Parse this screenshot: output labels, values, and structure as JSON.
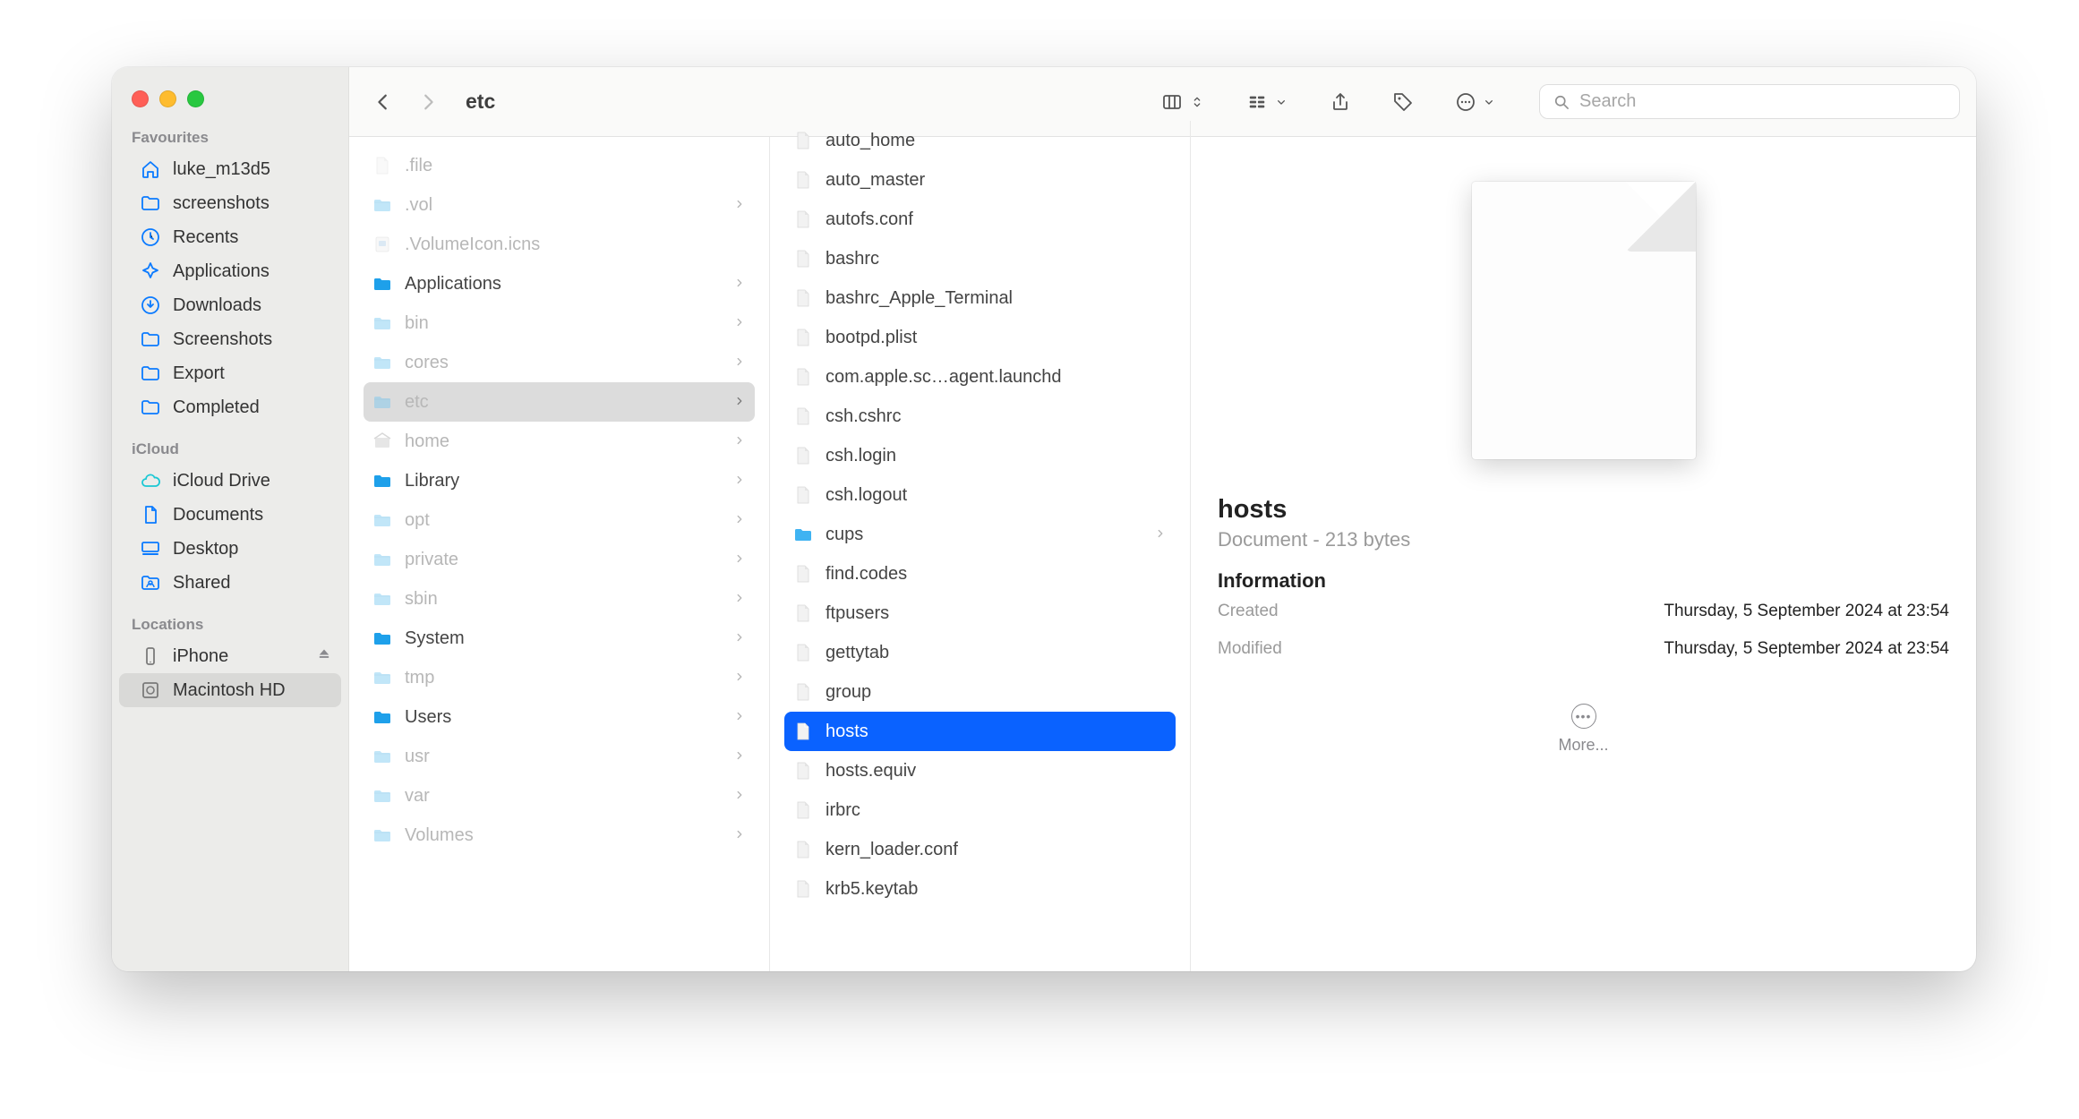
{
  "window": {
    "title": "etc"
  },
  "search": {
    "placeholder": "Search"
  },
  "sidebar": {
    "sections": [
      {
        "label": "Favourites",
        "items": [
          {
            "icon": "house",
            "label": "luke_m13d5"
          },
          {
            "icon": "folder",
            "label": "screenshots"
          },
          {
            "icon": "clock",
            "label": "Recents"
          },
          {
            "icon": "apps",
            "label": "Applications"
          },
          {
            "icon": "download",
            "label": "Downloads"
          },
          {
            "icon": "folder",
            "label": "Screenshots"
          },
          {
            "icon": "folder",
            "label": "Export"
          },
          {
            "icon": "folder",
            "label": "Completed"
          }
        ]
      },
      {
        "label": "iCloud",
        "items": [
          {
            "icon": "cloud",
            "label": "iCloud Drive"
          },
          {
            "icon": "doc",
            "label": "Documents"
          },
          {
            "icon": "desktop",
            "label": "Desktop"
          },
          {
            "icon": "shared",
            "label": "Shared"
          }
        ]
      },
      {
        "label": "Locations",
        "items": [
          {
            "icon": "iphone",
            "label": "iPhone",
            "eject": true
          },
          {
            "icon": "disk",
            "label": "Macintosh HD"
          }
        ]
      }
    ]
  },
  "columns": [
    [
      {
        "name": ".file",
        "type": "doc",
        "dim": true
      },
      {
        "name": ".vol",
        "type": "folder",
        "dim": true,
        "chev": true
      },
      {
        "name": ".VolumeIcon.icns",
        "type": "icns",
        "dim": true
      },
      {
        "name": "Applications",
        "type": "folder-app",
        "chev": true
      },
      {
        "name": "bin",
        "type": "folder",
        "dim": true,
        "chev": true
      },
      {
        "name": "cores",
        "type": "folder",
        "dim": true,
        "chev": true
      },
      {
        "name": "etc",
        "type": "folder",
        "dim": true,
        "chev": true,
        "selectedParent": true
      },
      {
        "name": "home",
        "type": "home",
        "dim": true,
        "chev": true
      },
      {
        "name": "Library",
        "type": "folder-lib",
        "chev": true
      },
      {
        "name": "opt",
        "type": "folder",
        "dim": true,
        "chev": true
      },
      {
        "name": "private",
        "type": "folder",
        "dim": true,
        "chev": true
      },
      {
        "name": "sbin",
        "type": "folder",
        "dim": true,
        "chev": true
      },
      {
        "name": "System",
        "type": "folder-sys",
        "chev": true
      },
      {
        "name": "tmp",
        "type": "folder",
        "dim": true,
        "chev": true
      },
      {
        "name": "Users",
        "type": "folder-users",
        "chev": true
      },
      {
        "name": "usr",
        "type": "folder",
        "dim": true,
        "chev": true
      },
      {
        "name": "var",
        "type": "folder",
        "dim": true,
        "chev": true
      },
      {
        "name": "Volumes",
        "type": "folder",
        "dim": true,
        "chev": true
      }
    ],
    [
      {
        "name": "auto_home",
        "type": "doc"
      },
      {
        "name": "auto_master",
        "type": "doc"
      },
      {
        "name": "autofs.conf",
        "type": "doc"
      },
      {
        "name": "bashrc",
        "type": "doc"
      },
      {
        "name": "bashrc_Apple_Terminal",
        "type": "doc"
      },
      {
        "name": "bootpd.plist",
        "type": "doc"
      },
      {
        "name": "com.apple.sc…agent.launchd",
        "type": "doc"
      },
      {
        "name": "csh.cshrc",
        "type": "doc"
      },
      {
        "name": "csh.login",
        "type": "doc"
      },
      {
        "name": "csh.logout",
        "type": "doc"
      },
      {
        "name": "cups",
        "type": "folder-solid",
        "chev": true
      },
      {
        "name": "find.codes",
        "type": "doc"
      },
      {
        "name": "ftpusers",
        "type": "doc"
      },
      {
        "name": "gettytab",
        "type": "doc"
      },
      {
        "name": "group",
        "type": "doc"
      },
      {
        "name": "hosts",
        "type": "doc",
        "selected": true
      },
      {
        "name": "hosts.equiv",
        "type": "doc"
      },
      {
        "name": "irbrc",
        "type": "doc"
      },
      {
        "name": "kern_loader.conf",
        "type": "doc"
      },
      {
        "name": "krb5.keytab",
        "type": "doc"
      }
    ]
  ],
  "preview": {
    "name": "hosts",
    "subtitle": "Document - 213 bytes",
    "info_heading": "Information",
    "created_label": "Created",
    "created_value": "Thursday, 5 September 2024 at 23:54",
    "modified_label": "Modified",
    "modified_value": "Thursday, 5 September 2024 at 23:54",
    "more": "More..."
  }
}
